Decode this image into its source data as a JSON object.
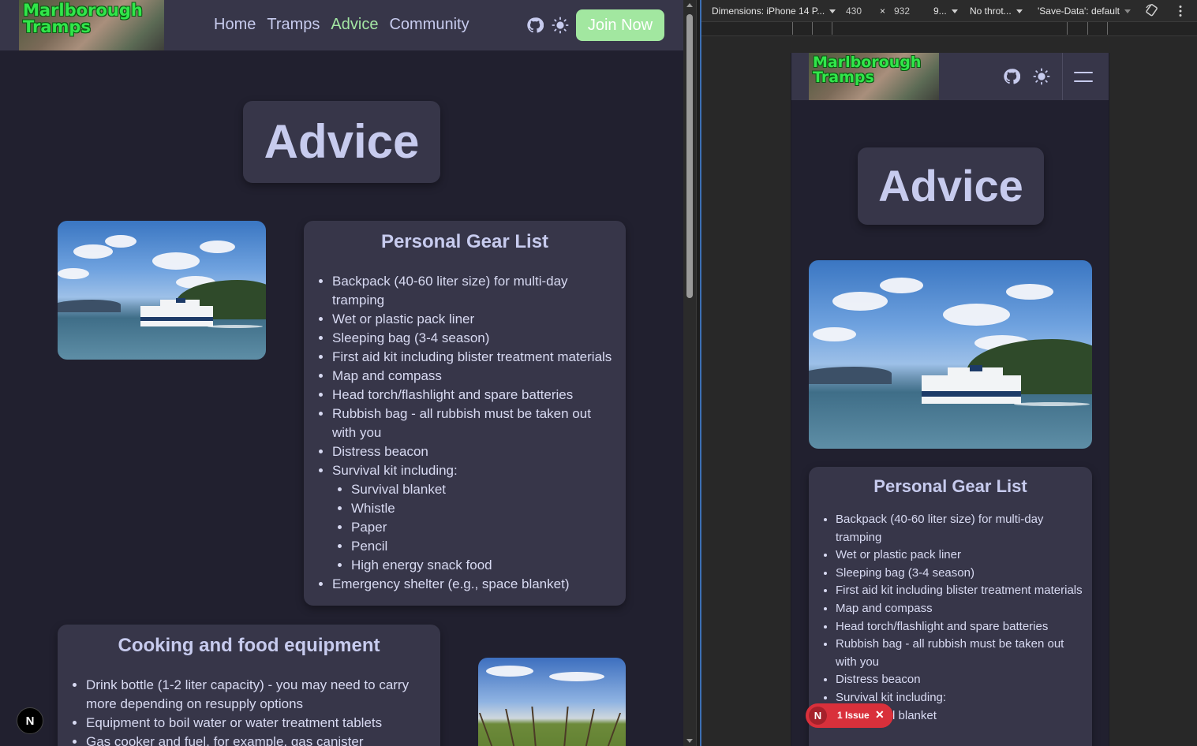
{
  "site": {
    "logo_line1": "Marlborough",
    "logo_line2": "Tramps",
    "nav": [
      "Home",
      "Tramps",
      "Advice",
      "Community"
    ],
    "active_nav": "Advice",
    "join_label": "Join Now",
    "page_title": "Advice",
    "colors": {
      "background": "#21202f",
      "card": "#373649",
      "title_text": "#c7cbee",
      "active_link": "#a3e6a3",
      "join_button": "#a2e7a0",
      "logo_green": "#31e64a"
    },
    "icons": [
      "github-icon",
      "sun-icon",
      "menu-icon"
    ]
  },
  "gear": {
    "title": "Personal Gear List",
    "items": [
      "Backpack (40-60 liter size) for multi-day tramping",
      "Wet or plastic pack liner",
      "Sleeping bag (3-4 season)",
      "First aid kit including blister treatment materials",
      "Map and compass",
      "Head torch/flashlight and spare batteries",
      "Rubbish bag - all rubbish must be taken out with you",
      "Distress beacon",
      "Survival kit including:"
    ],
    "survival_items": [
      "Survival blanket",
      "Whistle",
      "Paper",
      "Pencil",
      "High energy snack food"
    ],
    "last_item": "Emergency shelter (e.g., space blanket)"
  },
  "cooking": {
    "title": "Cooking and food equipment",
    "items": [
      "Drink bottle (1-2 liter capacity) - you may need to carry more depending on resupply options",
      "Equipment to boil water or water treatment tablets",
      "Gas cooker and fuel, for example, gas canister"
    ]
  },
  "mobile_gear_items": [
    "Backpack (40-60 liter size) for multi-day tramping",
    "Wet or plastic pack liner",
    "Sleeping bag (3-4 season)",
    "First aid kit including blister treatment materials",
    "Map and compass",
    "Head torch/flashlight and spare batteries",
    "Rubbish bag - all rubbish must be taken out with you",
    "Distress beacon",
    "Survival kit including:"
  ],
  "mobile_survival_first": "Survival blanket",
  "nextjs": {
    "badge": "N",
    "issue_label": "1 Issue",
    "close_glyph": "✕"
  },
  "devtools": {
    "dimensions": "Dimensions: iPhone 14 P...",
    "width": "430",
    "times": "×",
    "height": "932",
    "zoom": "9...",
    "throttle": "No throt...",
    "save_data": "'Save-Data': default"
  }
}
